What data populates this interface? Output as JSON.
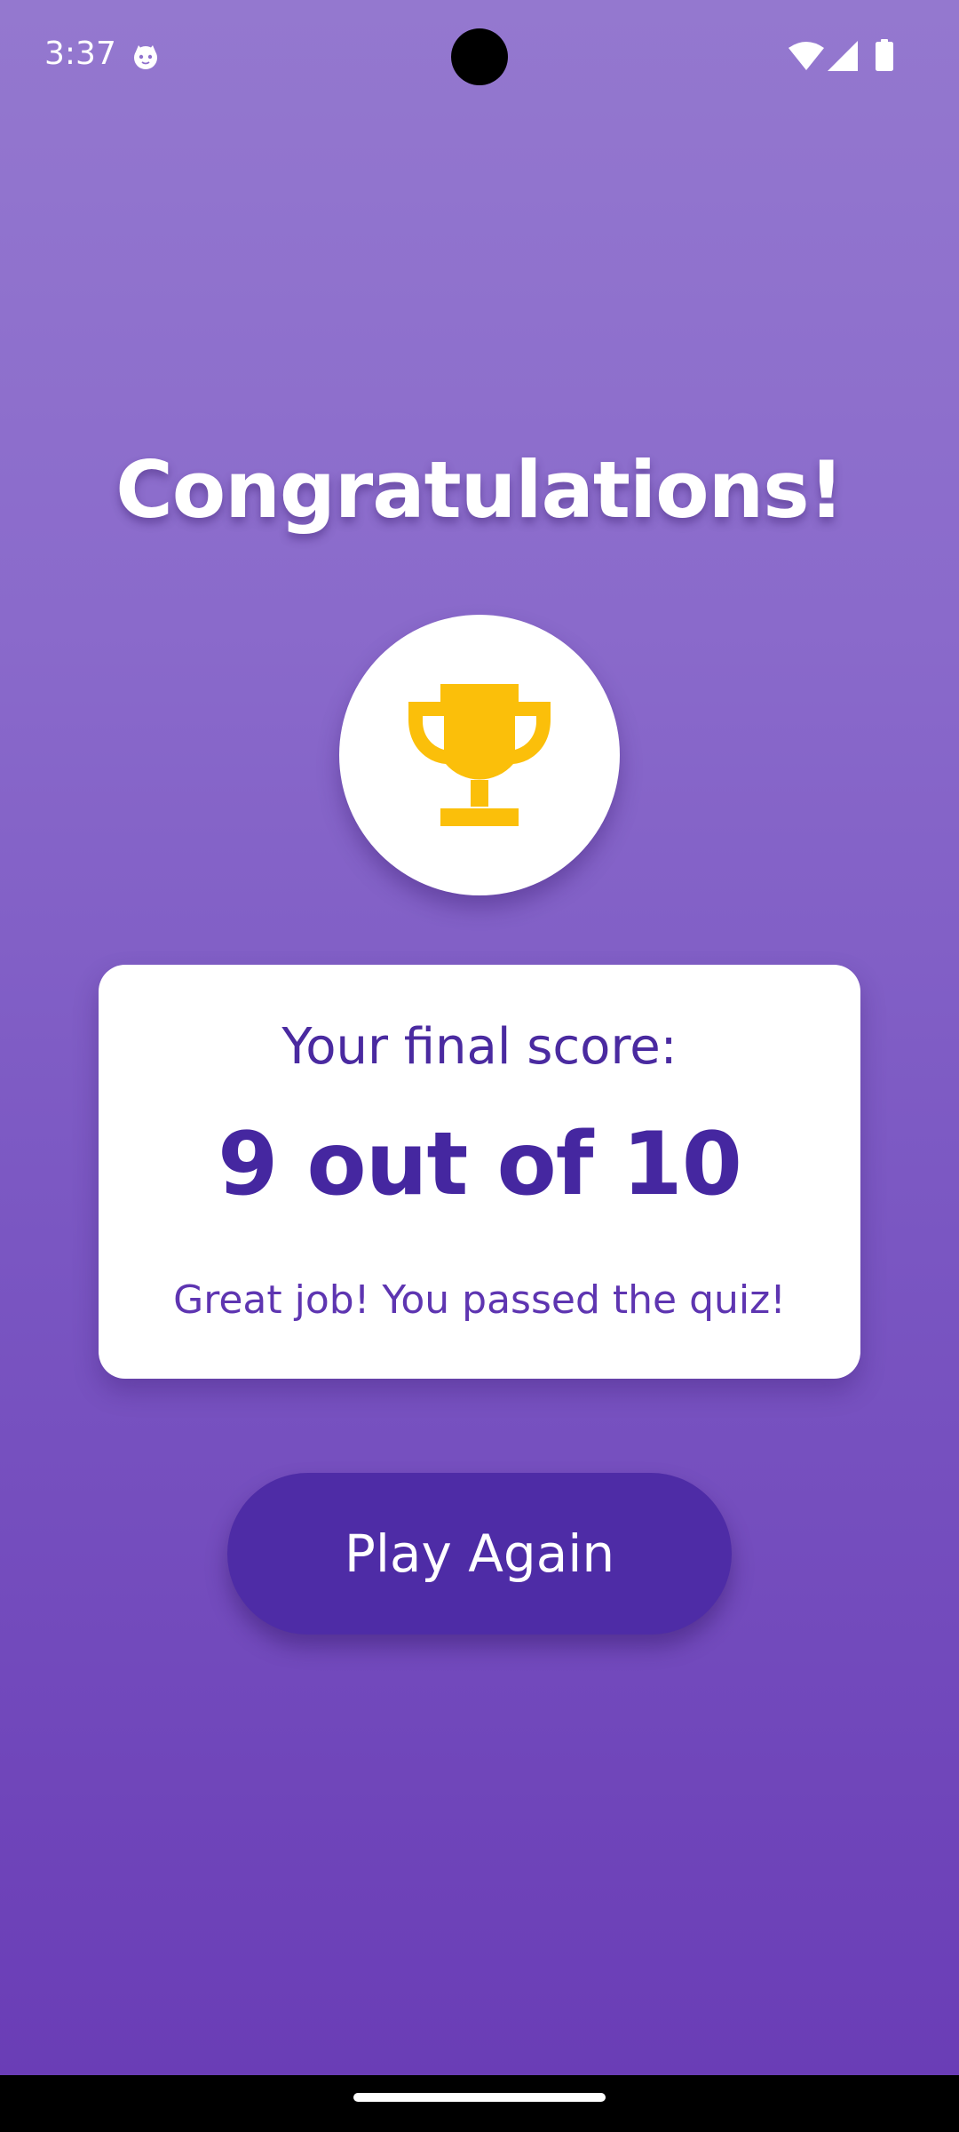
{
  "status_bar": {
    "time": "3:37",
    "app_icon": "android-cat-icon",
    "icons": [
      "wifi-icon",
      "signal-icon",
      "battery-icon"
    ]
  },
  "quiz_result": {
    "title": "Congratulations!",
    "trophy_icon": "trophy-icon",
    "score_label": "Your final score:",
    "score_value": "9 out of 10",
    "message": "Great job! You passed the quiz!",
    "play_again_label": "Play Again"
  },
  "colors": {
    "background_top": "#9478cf",
    "background_bottom": "#6a3db6",
    "trophy": "#fbbf0a",
    "score_text": "#4527a0",
    "button": "#4e2ca6"
  }
}
